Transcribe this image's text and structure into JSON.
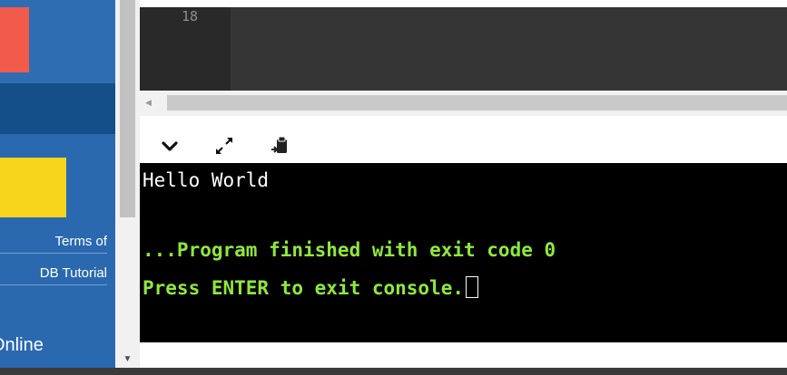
{
  "sidebar": {
    "links": [
      "Terms of",
      "DB Tutorial"
    ],
    "online_label": "Online"
  },
  "editor": {
    "line_number": "18"
  },
  "console_toolbar": {
    "icons": [
      "chevron-down-icon",
      "expand-icon",
      "copy-clipboard-icon"
    ]
  },
  "console": {
    "output": "Hello World",
    "finish_message": "...Program finished with exit code 0",
    "prompt": "Press ENTER to exit console."
  },
  "colors": {
    "sidebar_blue": "#2a69b0",
    "console_green": "#8fe83a",
    "console_bg": "#000000"
  }
}
